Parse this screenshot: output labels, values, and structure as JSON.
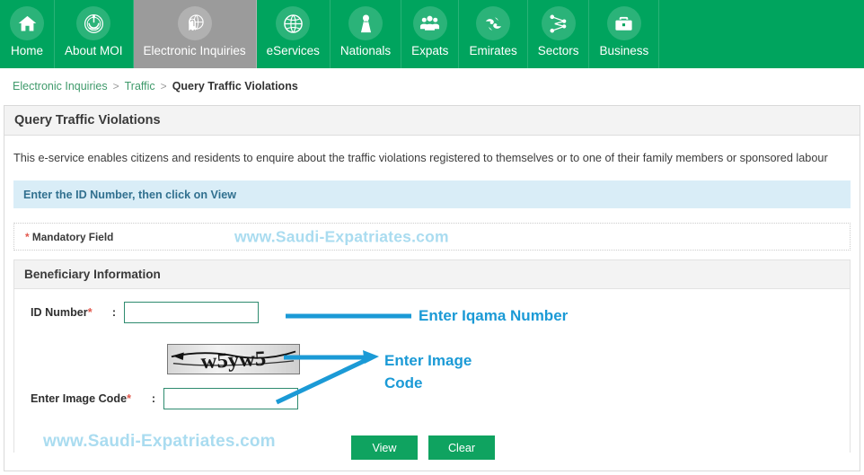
{
  "nav": {
    "items": [
      {
        "label": "Home",
        "icon": "home-icon",
        "active": false
      },
      {
        "label": "About MOI",
        "icon": "moi-emblem-icon",
        "active": false
      },
      {
        "label": "Electronic Inquiries",
        "icon": "fingerprint-globe-icon",
        "active": true
      },
      {
        "label": "eServices",
        "icon": "globe-icon",
        "active": false
      },
      {
        "label": "Nationals",
        "icon": "person-thobe-icon",
        "active": false
      },
      {
        "label": "Expats",
        "icon": "group-people-icon",
        "active": false
      },
      {
        "label": "Emirates",
        "icon": "birds-icon",
        "active": false
      },
      {
        "label": "Sectors",
        "icon": "network-nodes-icon",
        "active": false
      },
      {
        "label": "Business",
        "icon": "briefcase-icon",
        "active": false
      }
    ]
  },
  "breadcrumb": {
    "items": [
      "Electronic Inquiries",
      "Traffic",
      "Query Traffic Violations"
    ],
    "separator": ">"
  },
  "panel": {
    "title": "Query Traffic Violations",
    "description": "This e-service enables citizens and residents to enquire about the traffic violations registered to themselves or to one of their family members or sponsored labour",
    "info_bar": "Enter the ID Number, then click on View",
    "mandatory_note": "Mandatory Field",
    "mandatory_star": "*"
  },
  "section": {
    "title": "Beneficiary Information",
    "fields": [
      {
        "label": "ID Number",
        "star": "*",
        "colon": ":",
        "value": "",
        "placeholder": ""
      },
      {
        "label": "Enter Image Code",
        "star": "*",
        "colon": ":",
        "value": "",
        "placeholder": ""
      }
    ],
    "captcha": {
      "text": "w5yw5",
      "alt": "captcha-image"
    },
    "buttons": {
      "view": "View",
      "clear": "Clear"
    }
  },
  "annotations": {
    "iqama": "Enter Iqama Number",
    "image_code": "Enter Image\nCode",
    "color": "#1b9ad6"
  },
  "watermarks": {
    "top": "www.Saudi-Expatriates.com",
    "bottom": "www.Saudi-Expatriates.com",
    "color": "#aadcf0"
  },
  "colors": {
    "nav_green": "#00a45e",
    "nav_active_grey": "#9b9b9b",
    "button_green": "#0fa360",
    "input_border_teal": "#2e8b6f",
    "info_blue_bg": "#d9edf7",
    "info_blue_text": "#31708f",
    "required_star_red": "#e2574c",
    "breadcrumb_link_green": "#3f9a6b"
  }
}
